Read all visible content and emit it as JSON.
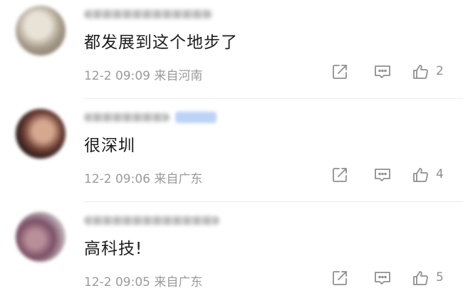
{
  "comments": [
    {
      "text": "都发展到这个地步了",
      "time": "12-2 09:09",
      "location": "来自河南",
      "likes": "2"
    },
    {
      "text": "很深圳",
      "time": "12-2 09:06",
      "location": "来自广东",
      "likes": "4"
    },
    {
      "text": "高科技!",
      "time": "12-2 09:05",
      "location": "来自广东",
      "likes": "5"
    }
  ],
  "icons": {
    "share": "share-icon",
    "reply": "comment-icon",
    "like": "thumbs-up-icon"
  },
  "colors": {
    "text": "#1d1d1d",
    "meta": "#9a9a9a",
    "icon": "#8f8f8f",
    "badge": "#bcd3f5"
  }
}
